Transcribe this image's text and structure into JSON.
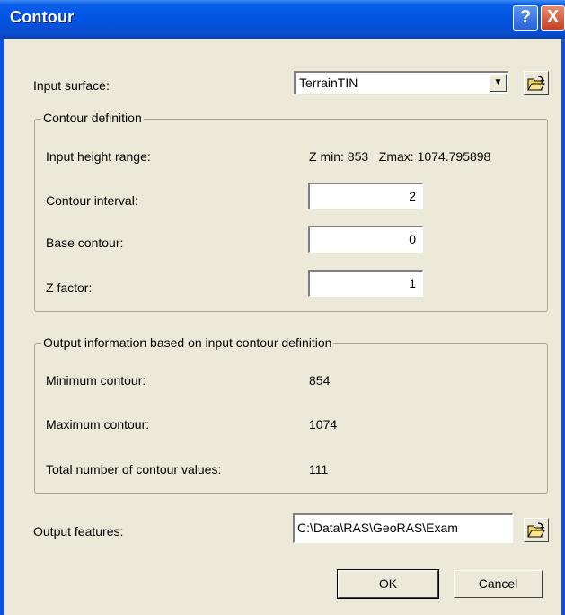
{
  "window": {
    "title": "Contour",
    "help_button": "?",
    "close_button": "X"
  },
  "input_surface": {
    "label": "Input surface:",
    "selected": "TerrainTIN"
  },
  "contour_definition": {
    "group_label": "Contour definition",
    "height_range_label": "Input height range:",
    "height_range_value": "Z min: 853   Zmax: 1074.795898",
    "interval_label": "Contour interval:",
    "interval_value": "2",
    "base_label": "Base contour:",
    "base_value": "0",
    "zfactor_label": "Z factor:",
    "zfactor_value": "1"
  },
  "output_info": {
    "group_label": "Output information based on input contour definition",
    "min_label": "Minimum contour:",
    "min_value": "854",
    "max_label": "Maximum contour:",
    "max_value": "1074",
    "total_label": "Total number of contour values:",
    "total_value": "111"
  },
  "output_features": {
    "label": "Output features:",
    "value": "C:\\Data\\RAS\\GeoRAS\\Exam"
  },
  "buttons": {
    "ok": "OK",
    "cancel": "Cancel"
  },
  "icons": {
    "browse": "open-folder-icon",
    "dropdown": "chevron-down-icon"
  }
}
